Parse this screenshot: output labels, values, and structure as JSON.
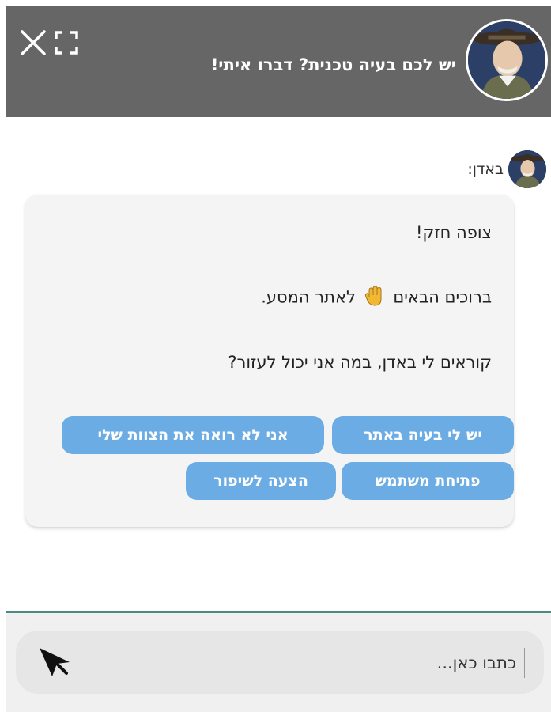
{
  "header": {
    "title": "יש לכם בעיה טכנית? דברו איתי!",
    "avatar_icon": "scout-leader-portrait",
    "close_icon": "close-icon",
    "expand_icon": "expand-icon"
  },
  "chat": {
    "sender_name": "באדן:",
    "message": {
      "line1": "צופה חזק!",
      "line2_before": "ברוכים הבאים",
      "line2_emoji": "👋",
      "line2_after": "לאתר המסע.",
      "line3": "קוראים לי באדן, במה אני יכול לעזור?"
    },
    "quick_replies": [
      "יש לי בעיה באתר",
      "אני לא רואה את הצוות שלי",
      "פתיחת משתמש",
      "הצעה לשיפור"
    ]
  },
  "composer": {
    "placeholder": "כתבו כאן...",
    "send_icon": "send-icon"
  },
  "colors": {
    "header_bg": "#666666",
    "quick_reply_bg": "#6aace3",
    "divider": "#4d8a86",
    "bubble_bg": "#f4f4f4"
  }
}
